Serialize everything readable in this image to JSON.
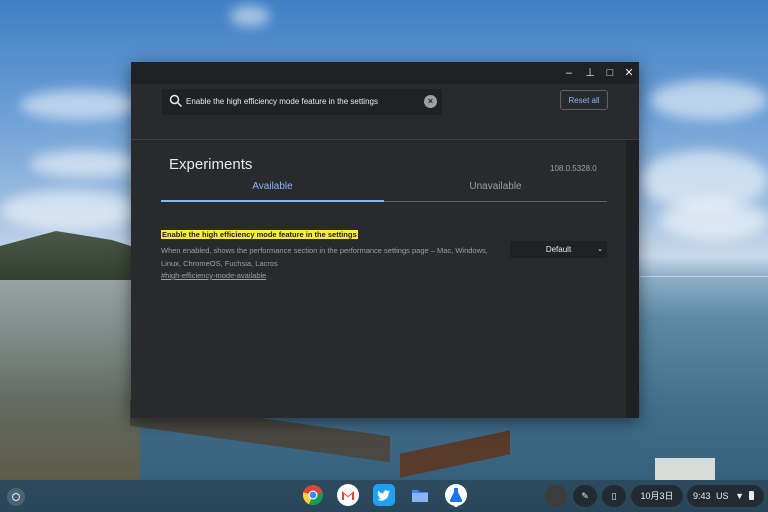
{
  "window": {
    "controls": {
      "minimize": "–",
      "pin": "⊥",
      "maximize": "□",
      "close": "✕"
    }
  },
  "search": {
    "value": "Enable the high efficiency mode feature in the settings",
    "clear_icon": "clear-icon",
    "search_icon": "search-icon"
  },
  "toolbar": {
    "reset_label": "Reset all"
  },
  "page": {
    "title": "Experiments",
    "version": "108.0.5328.0"
  },
  "tabs": [
    {
      "label": "Available",
      "active": true
    },
    {
      "label": "Unavailable",
      "active": false
    }
  ],
  "experiment": {
    "name": "Enable the high efficiency mode feature in the settings",
    "description": "When enabled, shows the performance section in the performance settings page – Mac, Windows, Linux, ChromeOS, Fuchsia, Lacros",
    "link": "#high-efficiency-mode-available",
    "selected_option": "Default"
  },
  "shelf": {
    "apps": [
      "chrome-icon",
      "gmail-icon",
      "twitter-icon",
      "files-icon",
      "chrome-labs-icon"
    ],
    "date": "10月3日",
    "time": "9:43",
    "locale": "US"
  },
  "colors": {
    "accent": "#8ab4f8",
    "highlight": "#ffeb3b",
    "window_bg": "#202124",
    "content_bg": "#292a2d"
  }
}
